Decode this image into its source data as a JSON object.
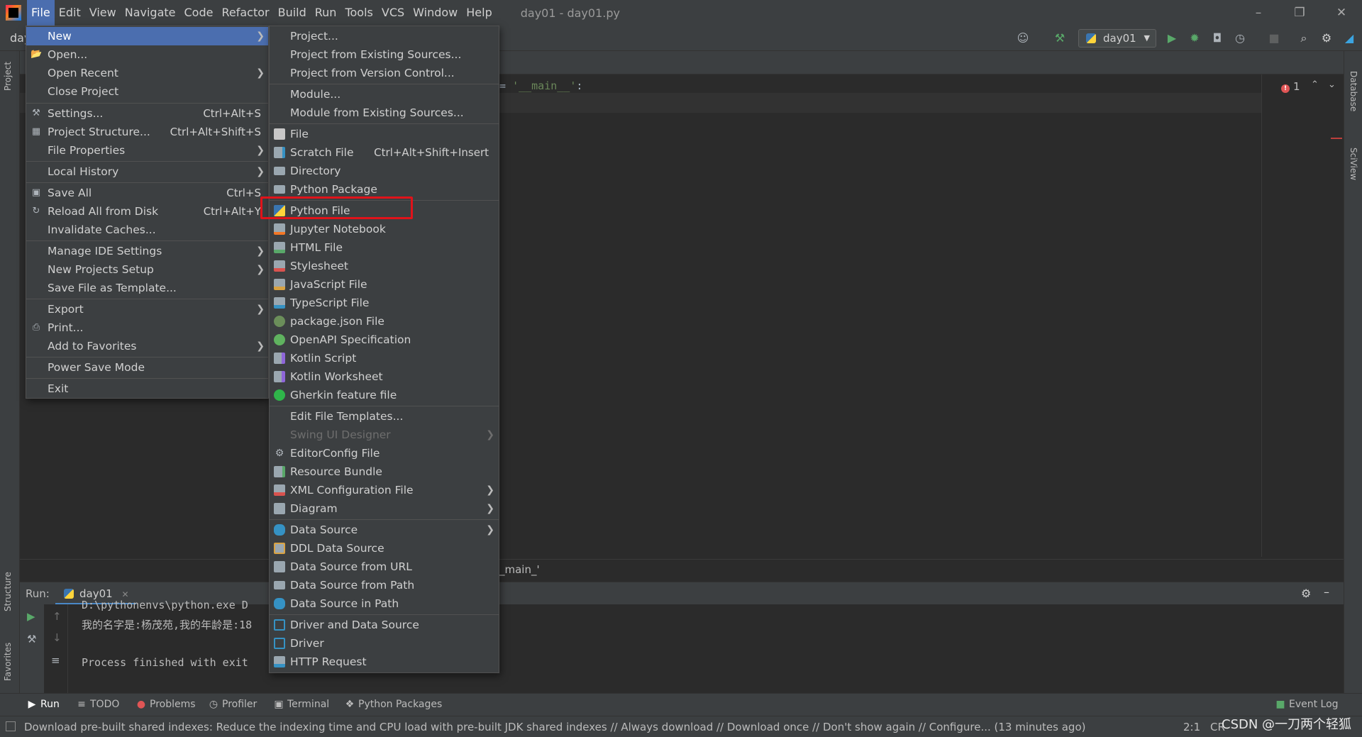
{
  "menubar": {
    "items": [
      "File",
      "Edit",
      "View",
      "Navigate",
      "Code",
      "Refactor",
      "Build",
      "Run",
      "Tools",
      "VCS",
      "Window",
      "Help"
    ],
    "window_title": "day01 - day01.py"
  },
  "toolbar": {
    "breadcrumb": "day",
    "run_config": "day01"
  },
  "left_strip": {
    "project": "Project",
    "structure": "Structure",
    "favorites": "Favorites"
  },
  "right_strip": {
    "database": "Database",
    "sciview": "SciView"
  },
  "editor": {
    "code_prefix": "= ",
    "code_string": "'__main__'",
    "code_suffix": ":",
    "error_count": "1",
    "breadcrumb": "_main_'"
  },
  "file_menu": {
    "items": [
      {
        "label": "New",
        "shortcut": "",
        "submenu": true
      },
      {
        "label": "Open...",
        "shortcut": ""
      },
      {
        "label": "Open Recent",
        "shortcut": "",
        "submenu": true
      },
      {
        "label": "Close Project",
        "shortcut": ""
      },
      {
        "label": "Settings...",
        "shortcut": "Ctrl+Alt+S"
      },
      {
        "label": "Project Structure...",
        "shortcut": "Ctrl+Alt+Shift+S"
      },
      {
        "label": "File Properties",
        "shortcut": "",
        "submenu": true
      },
      {
        "label": "Local History",
        "shortcut": "",
        "submenu": true
      },
      {
        "label": "Save All",
        "shortcut": "Ctrl+S"
      },
      {
        "label": "Reload All from Disk",
        "shortcut": "Ctrl+Alt+Y"
      },
      {
        "label": "Invalidate Caches...",
        "shortcut": ""
      },
      {
        "label": "Manage IDE Settings",
        "shortcut": "",
        "submenu": true
      },
      {
        "label": "New Projects Setup",
        "shortcut": "",
        "submenu": true
      },
      {
        "label": "Save File as Template...",
        "shortcut": ""
      },
      {
        "label": "Export",
        "shortcut": "",
        "submenu": true
      },
      {
        "label": "Print...",
        "shortcut": ""
      },
      {
        "label": "Add to Favorites",
        "shortcut": "",
        "submenu": true
      },
      {
        "label": "Power Save Mode",
        "shortcut": ""
      },
      {
        "label": "Exit",
        "shortcut": ""
      }
    ]
  },
  "new_menu": {
    "items": [
      {
        "label": "Project...",
        "shortcut": ""
      },
      {
        "label": "Project from Existing Sources...",
        "shortcut": ""
      },
      {
        "label": "Project from Version Control...",
        "shortcut": ""
      },
      {
        "label": "Module...",
        "shortcut": ""
      },
      {
        "label": "Module from Existing Sources...",
        "shortcut": ""
      },
      {
        "label": "File",
        "shortcut": ""
      },
      {
        "label": "Scratch File",
        "shortcut": "Ctrl+Alt+Shift+Insert"
      },
      {
        "label": "Directory",
        "shortcut": ""
      },
      {
        "label": "Python Package",
        "shortcut": ""
      },
      {
        "label": "Python File",
        "shortcut": ""
      },
      {
        "label": "Jupyter Notebook",
        "shortcut": ""
      },
      {
        "label": "HTML File",
        "shortcut": ""
      },
      {
        "label": "Stylesheet",
        "shortcut": ""
      },
      {
        "label": "JavaScript File",
        "shortcut": ""
      },
      {
        "label": "TypeScript File",
        "shortcut": ""
      },
      {
        "label": "package.json File",
        "shortcut": ""
      },
      {
        "label": "OpenAPI Specification",
        "shortcut": ""
      },
      {
        "label": "Kotlin Script",
        "shortcut": ""
      },
      {
        "label": "Kotlin Worksheet",
        "shortcut": ""
      },
      {
        "label": "Gherkin feature file",
        "shortcut": ""
      },
      {
        "label": "Edit File Templates...",
        "shortcut": ""
      },
      {
        "label": "Swing UI Designer",
        "shortcut": "",
        "disabled": true
      },
      {
        "label": "EditorConfig File",
        "shortcut": ""
      },
      {
        "label": "Resource Bundle",
        "shortcut": ""
      },
      {
        "label": "XML Configuration File",
        "shortcut": ""
      },
      {
        "label": "Diagram",
        "shortcut": ""
      },
      {
        "label": "Data Source",
        "shortcut": ""
      },
      {
        "label": "DDL Data Source",
        "shortcut": ""
      },
      {
        "label": "Data Source from URL",
        "shortcut": ""
      },
      {
        "label": "Data Source from Path",
        "shortcut": ""
      },
      {
        "label": "Data Source in Path",
        "shortcut": ""
      },
      {
        "label": "Driver and Data Source",
        "shortcut": ""
      },
      {
        "label": "Driver",
        "shortcut": ""
      },
      {
        "label": "HTTP Request",
        "shortcut": ""
      }
    ]
  },
  "run_panel": {
    "label": "Run:",
    "tab": "day01",
    "console_lines": [
      "D:\\pythonenvs\\python.exe D",
      "我的名字是:杨茂苑,我的年龄是:18",
      "",
      "Process finished with exit"
    ]
  },
  "bottom_bar": {
    "items": [
      "Run",
      "TODO",
      "Problems",
      "Profiler",
      "Terminal",
      "Python Packages"
    ],
    "event_log": "Event Log"
  },
  "status_bar": {
    "message": "Download pre-built shared indexes: Reduce the indexing time and CPU load with pre-built JDK shared indexes // Always download // Download once // Don't show again // Configure... (13 minutes ago)",
    "position": "2:1",
    "encoding": "CR"
  },
  "watermark": "CSDN @一刀两个轻狐"
}
